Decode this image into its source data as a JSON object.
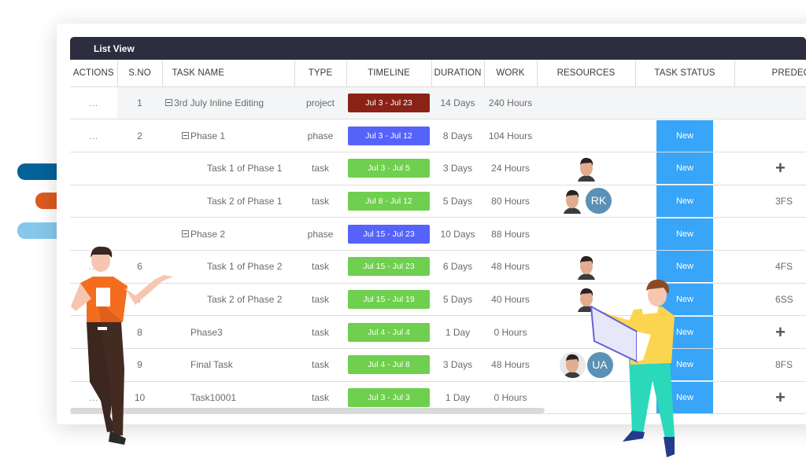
{
  "panel": {
    "title": "List View"
  },
  "columns": [
    {
      "key": "actions",
      "label": "ACTIONS"
    },
    {
      "key": "sno",
      "label": "S.NO"
    },
    {
      "key": "task_name",
      "label": "TASK NAME"
    },
    {
      "key": "type",
      "label": "TYPE"
    },
    {
      "key": "timeline",
      "label": "TIMELINE"
    },
    {
      "key": "duration",
      "label": "DURATION"
    },
    {
      "key": "work",
      "label": "WORK"
    },
    {
      "key": "resources",
      "label": "RESOURCES"
    },
    {
      "key": "task_status",
      "label": "TASK STATUS"
    },
    {
      "key": "predecessor",
      "label": "PREDECESSO"
    }
  ],
  "colors": {
    "header_bar": "#2c2d3e",
    "project_pill": "#8b2216",
    "phase_pill": "#5663fb",
    "task_pill": "#6fcf4e",
    "status_new": "#2ea1f8",
    "avatar_rk": "#5b91b5",
    "avatar_ua": "#5b91b5",
    "deco_blue": "#04629a",
    "deco_orange": "#db5a1f",
    "deco_lightblue": "#86c8ec"
  },
  "rows": [
    {
      "actions": "...",
      "sno": "1",
      "name": "3rd July Inline Editing",
      "expandable": true,
      "indent": 0,
      "type": "project",
      "timeline": "Jul 3 - Jul 23",
      "pill": "project",
      "duration": "14 Days",
      "work": "240 Hours",
      "resources": [],
      "status": "",
      "predecessor": ""
    },
    {
      "actions": "...",
      "sno": "2",
      "name": "Phase 1",
      "expandable": true,
      "indent": 1,
      "type": "phase",
      "timeline": "Jul 3 - Jul 12",
      "pill": "phase",
      "duration": "8 Days",
      "work": "104 Hours",
      "resources": [],
      "status": "New",
      "predecessor": ""
    },
    {
      "actions": "",
      "sno": "",
      "name": "Task 1 of Phase 1",
      "expandable": false,
      "indent": 2,
      "type": "task",
      "timeline": "Jul 3 - Jul 5",
      "pill": "task",
      "duration": "3 Days",
      "work": "24 Hours",
      "resources": [
        {
          "kind": "photo"
        }
      ],
      "status": "New",
      "predecessor": "+"
    },
    {
      "actions": "",
      "sno": "",
      "name": "Task 2 of Phase 1",
      "expandable": false,
      "indent": 2,
      "type": "task",
      "timeline": "Jul 8 - Jul 12",
      "pill": "task",
      "duration": "5 Days",
      "work": "80 Hours",
      "resources": [
        {
          "kind": "photo"
        },
        {
          "kind": "initials",
          "text": "RK"
        }
      ],
      "status": "New",
      "predecessor": "3FS"
    },
    {
      "actions": "",
      "sno": "",
      "name": "Phase 2",
      "expandable": true,
      "indent": 1,
      "type": "phase",
      "timeline": "Jul 15 - Jul 23",
      "pill": "phase",
      "duration": "10 Days",
      "work": "88 Hours",
      "resources": [],
      "status": "New",
      "predecessor": ""
    },
    {
      "actions": "...",
      "sno": "6",
      "name": "Task 1 of Phase 2",
      "expandable": false,
      "indent": 2,
      "type": "task",
      "timeline": "Jul 15 - Jul 23",
      "pill": "task",
      "duration": "6 Days",
      "work": "48 Hours",
      "resources": [
        {
          "kind": "photo"
        }
      ],
      "status": "New",
      "predecessor": "4FS"
    },
    {
      "actions": "",
      "sno": "7",
      "name": "Task 2 of Phase 2",
      "expandable": false,
      "indent": 2,
      "type": "task",
      "timeline": "Jul 15 - Jul 19",
      "pill": "task",
      "duration": "5 Days",
      "work": "40 Hours",
      "resources": [
        {
          "kind": "photo"
        }
      ],
      "status": "New",
      "predecessor": "6SS"
    },
    {
      "actions": "",
      "sno": "8",
      "name": "Phase3",
      "expandable": false,
      "indent": 1,
      "type": "task",
      "timeline": "Jul 4 - Jul 4",
      "pill": "task",
      "duration": "1 Day",
      "work": "0 Hours",
      "resources": [],
      "status": "New",
      "predecessor": "+"
    },
    {
      "actions": "",
      "sno": "9",
      "name": "Final Task",
      "expandable": false,
      "indent": 1,
      "type": "task",
      "timeline": "Jul 4 - Jul 8",
      "pill": "task",
      "duration": "3 Days",
      "work": "48 Hours",
      "resources": [
        {
          "kind": "photo-round"
        },
        {
          "kind": "initials",
          "text": "UA"
        }
      ],
      "status": "New",
      "predecessor": "8FS"
    },
    {
      "actions": "...",
      "sno": "10",
      "name": "Task10001",
      "expandable": false,
      "indent": 1,
      "type": "task",
      "timeline": "Jul 3 - Jul 3",
      "pill": "task",
      "duration": "1 Day",
      "work": "0 Hours",
      "resources": [],
      "status": "New",
      "predecessor": "+"
    }
  ],
  "icons": {
    "expander": "collapse-square-icon",
    "add_predecessor": "plus-icon",
    "actions": "more-dots-icon"
  }
}
